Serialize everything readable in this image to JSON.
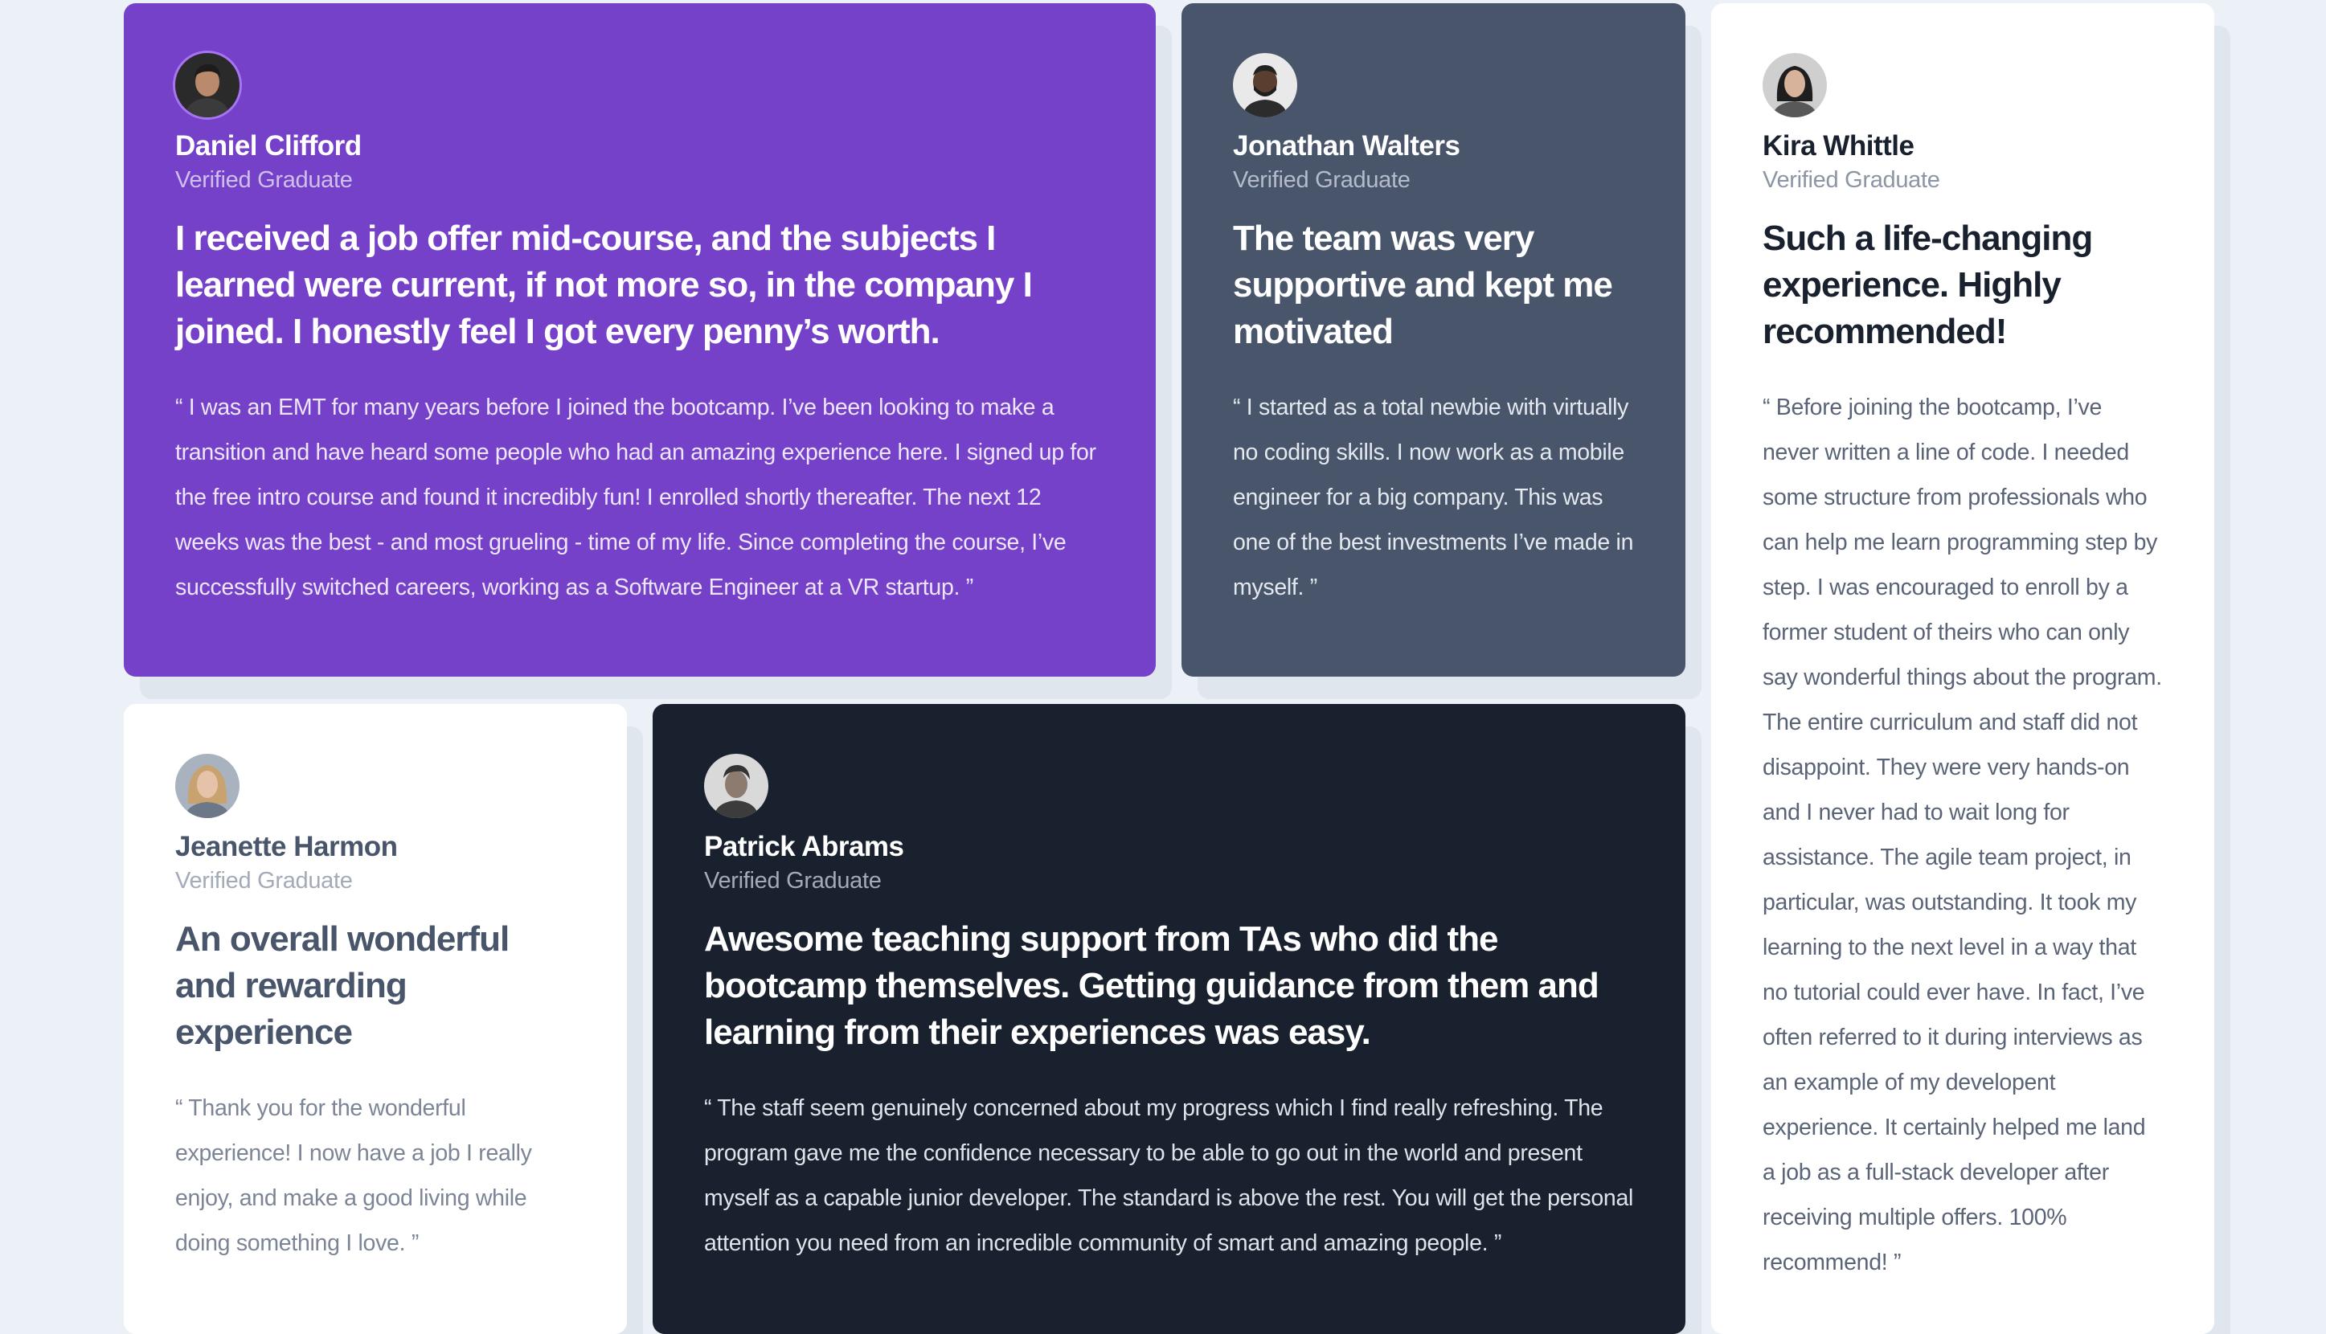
{
  "colors": {
    "page_background": "#ecf1f8",
    "moderate_violet": "#7541c8",
    "grayish_blue": "#48556a",
    "very_dark_blackish_blue": "#19212e",
    "white": "#ffffff"
  },
  "testimonials": {
    "daniel": {
      "avatar_icon": "avatar-daniel-clifford",
      "name": "Daniel Clifford",
      "role": "Verified Graduate",
      "headline": "I received a job offer mid-course, and the subjects I learned were current, if not more so, in the company I joined. I honestly feel I got every penny’s worth.",
      "quote": "“ I was an EMT for many years before I joined the bootcamp. I’ve been looking to make a transition and have heard some people who had an amazing experience here. I signed up for the free intro course and found it incredibly fun! I enrolled shortly thereafter. The next 12 weeks was the best - and most grueling - time of my life. Since completing the course, I’ve successfully switched careers, working as a Software Engineer at a VR startup. ”"
    },
    "jonathan": {
      "avatar_icon": "avatar-jonathan-walters",
      "name": "Jonathan Walters",
      "role": "Verified Graduate",
      "headline": "The team was very supportive and kept me motivated",
      "quote": "“ I started as a total newbie with virtually no coding skills. I now work as a mobile engineer for a big company. This was one of the best investments I’ve made in myself. ”"
    },
    "kira": {
      "avatar_icon": "avatar-kira-whittle",
      "name": "Kira Whittle",
      "role": "Verified Graduate",
      "headline": "Such a life-changing experience. Highly recommended!",
      "quote": "“ Before joining the bootcamp, I’ve never written a line of code. I needed some structure from professionals who can help me learn programming step by step. I was encouraged to enroll by a former student of theirs who can only say wonderful things about the program. The entire curriculum and staff did not disappoint. They were very hands-on and I never had to wait long for assistance. The agile team project, in particular, was outstanding. It took my learning to the next level in a way that no tutorial could ever have. In fact, I’ve often referred to it during interviews as an example of my developent experience. It certainly helped me land a job as a full-stack developer after receiving multiple offers. 100% recommend! ”"
    },
    "jeanette": {
      "avatar_icon": "avatar-jeanette-harmon",
      "name": "Jeanette Harmon",
      "role": "Verified Graduate",
      "headline": "An overall wonderful and rewarding experience",
      "quote": "“ Thank you for the wonderful experience! I now have a job I really enjoy, and make a good living while doing something I love. ”"
    },
    "patrick": {
      "avatar_icon": "avatar-patrick-abrams",
      "name": "Patrick Abrams",
      "role": "Verified Graduate",
      "headline": "Awesome teaching support from TAs who did the bootcamp themselves. Getting guidance from them and learning from their experiences was easy.",
      "quote": "“ The staff seem genuinely concerned about my progress which I find really refreshing. The program gave me the confidence necessary to be able to go out in the world and present myself as a capable junior developer. The standard is above the rest. You will get the personal attention you need from an incredible community of smart and amazing people. ”"
    }
  }
}
